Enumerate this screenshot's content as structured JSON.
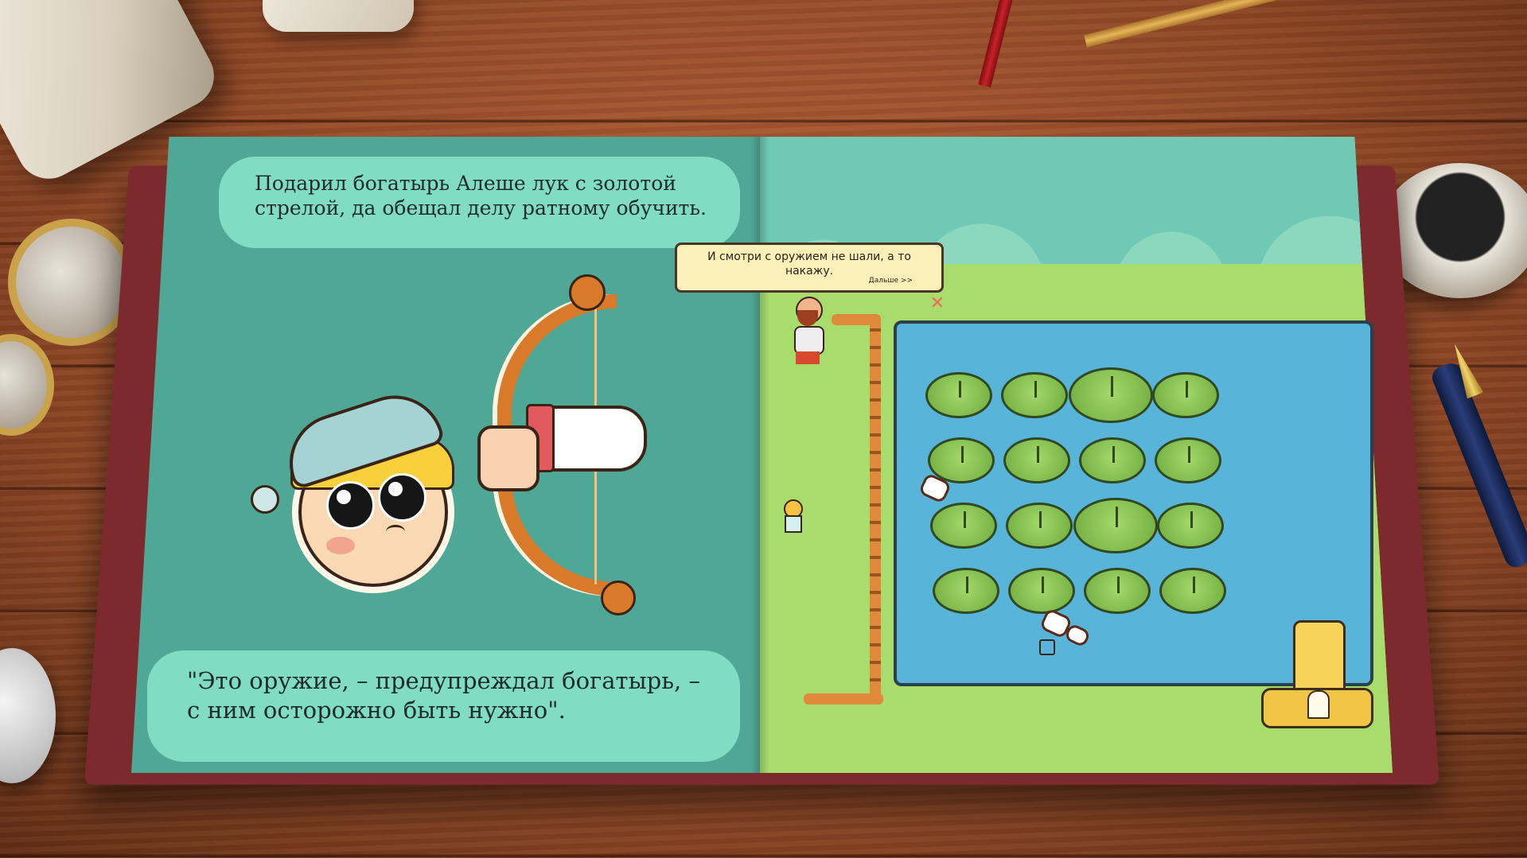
{
  "book": {
    "left_page": {
      "top_caption": "Подарил богатырь Алеше лук с золотой стрелой, да обещал делу ратному обучить.",
      "bottom_caption": "\"Это оружие, – предупреждал богатырь, – с ним осторожно быть нужно\"."
    },
    "right_page": {
      "dialog": {
        "text": "И смотри с оружием не шали, а то накажу.",
        "next_label": "Дальше >>"
      },
      "lily_pads_rows": 4,
      "lily_pads_per_row": 4
    }
  },
  "colors": {
    "left_page_bg": "#4fa896",
    "caption_bubble": "#80dcc3",
    "grass": "#a8dc6c",
    "pond_water": "#58b4d8",
    "dialog_bg": "#fbf0b8"
  },
  "icons": [
    "hand-cursor-icon",
    "target-marker-icon",
    "x-marker-icon"
  ]
}
